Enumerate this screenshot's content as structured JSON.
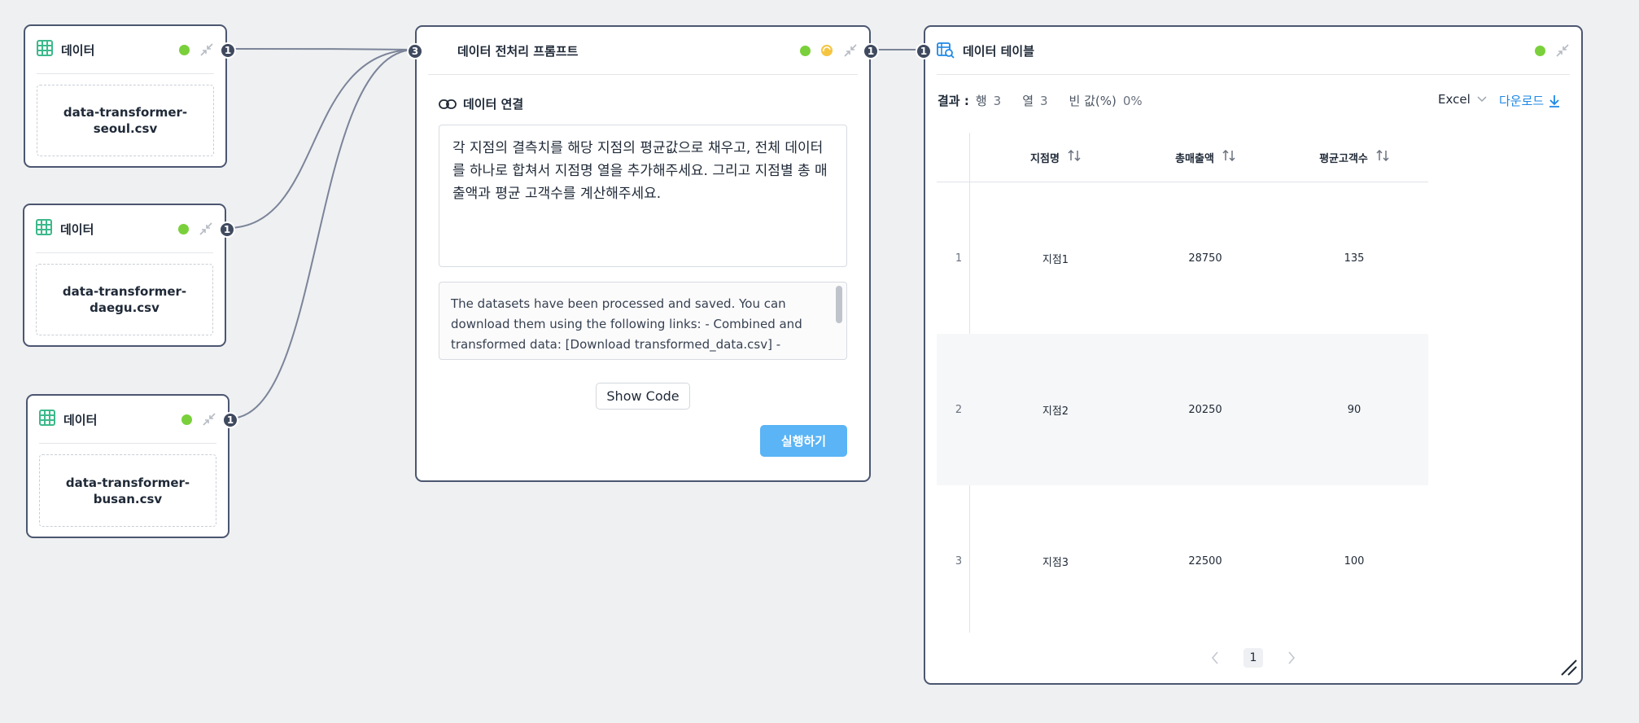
{
  "source_nodes": [
    {
      "title": "데이터",
      "filename": "data-transformer-seoul.csv",
      "port": "1"
    },
    {
      "title": "데이터",
      "filename": "data-transformer-daegu.csv",
      "port": "1"
    },
    {
      "title": "데이터",
      "filename": "data-transformer-busan.csv",
      "port": "1"
    }
  ],
  "prompt_node": {
    "title": "데이터 전처리 프롬프트",
    "input_port": "3",
    "output_port": "1",
    "section_label": "데이터 연결",
    "prompt_text": "각 지점의 결측치를 해당 지점의 평균값으로 채우고, 전체 데이터를 하나로 합쳐서 지점명 열을 추가해주세요. 그리고 지점별 총 매출액과 평균 고객수를 계산해주세요.",
    "result_text": "The datasets have been processed and saved. You can download them using the following links: - Combined and transformed data: [Download transformed_data.csv] - Branch-level aggregation: [Download branch_summary.csv]",
    "show_code_label": "Show Code",
    "run_label": "실행하기",
    "status_color": "#7ad03a",
    "loading_color": "#f5c542"
  },
  "table_node": {
    "title": "데이터 테이블",
    "input_port": "1",
    "summary": {
      "result_label": "결과 :",
      "rows_label": "행",
      "rows_value": "3",
      "cols_label": "열",
      "cols_value": "3",
      "empty_label": "빈 값(%)",
      "empty_value": "0%"
    },
    "format": "Excel",
    "download_label": "다운로드",
    "columns": [
      "지점명",
      "총매출액",
      "평균고객수"
    ],
    "rows": [
      {
        "index": "1",
        "cells": [
          "지점1",
          "28750",
          "135"
        ]
      },
      {
        "index": "2",
        "cells": [
          "지점2",
          "20250",
          "90"
        ]
      },
      {
        "index": "3",
        "cells": [
          "지점3",
          "22500",
          "100"
        ]
      }
    ],
    "page": "1"
  },
  "accent_color": "#1e88e5",
  "icons": [
    "grid-icon",
    "collapse-icon",
    "link-icon",
    "table-search-icon",
    "sort-icon",
    "chevron-down-icon",
    "download-icon",
    "chevron-left-icon",
    "chevron-right-icon",
    "resize-icon"
  ]
}
